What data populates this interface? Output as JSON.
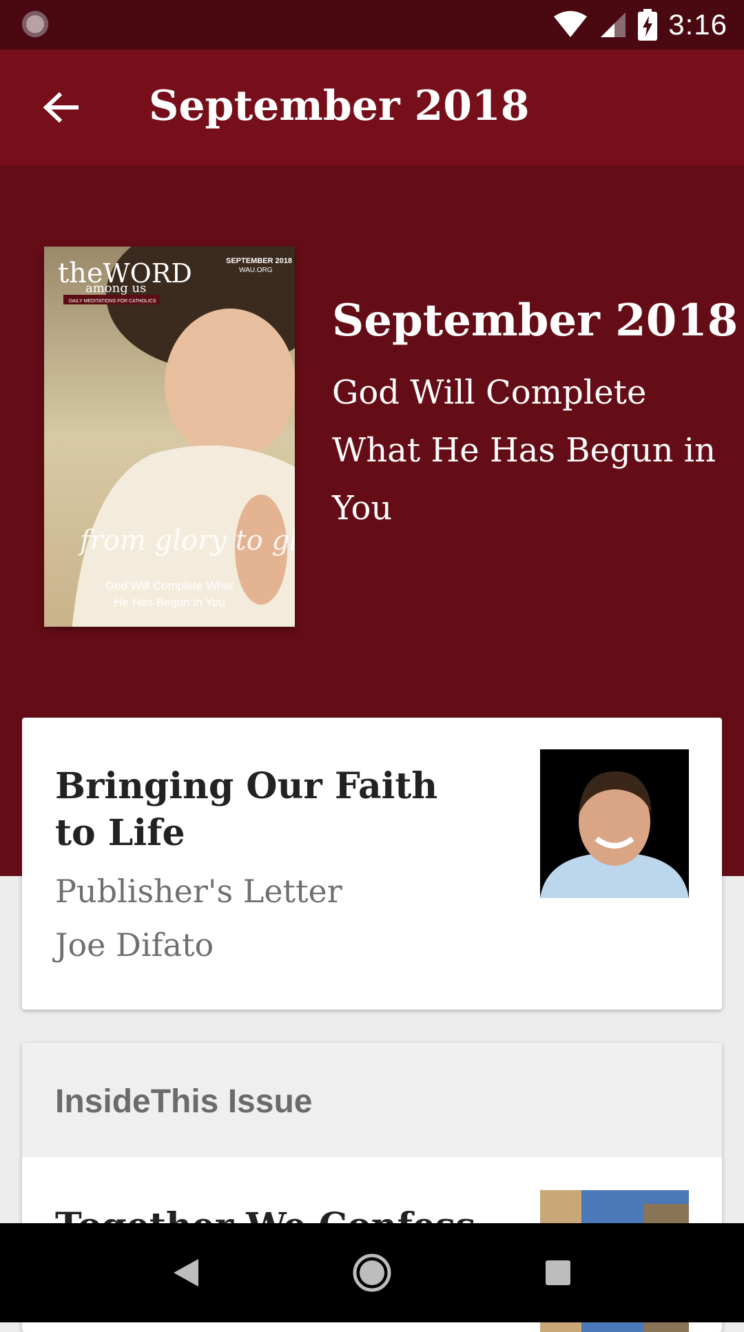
{
  "status_bar": {
    "time": "3:16"
  },
  "toolbar": {
    "title": "September 2018"
  },
  "issue": {
    "title": "September 2018",
    "subtitle": "God Will Complete What He Has Begun in You",
    "cover": {
      "brand_small": "THE",
      "brand_word": "the WORD",
      "brand_among": "among us",
      "tagline": "DAILY MEDITATIONS FOR CATHOLICS",
      "date": "SEPTEMBER 2018",
      "site": "WAU.ORG",
      "script_title": "from glory to glory",
      "caption_line1": "God Will Complete What",
      "caption_line2": "He Has Begun in You"
    }
  },
  "featured_article": {
    "title": "Bringing Our Faith to Life",
    "category": "Publisher's Letter",
    "author": "Joe Difato"
  },
  "inside_section": {
    "header": "InsideThis Issue",
    "first_item_title": "Together We Confess"
  },
  "colors": {
    "status_bar": "#4a0911",
    "toolbar": "#760f1a",
    "hero": "#650d16"
  }
}
